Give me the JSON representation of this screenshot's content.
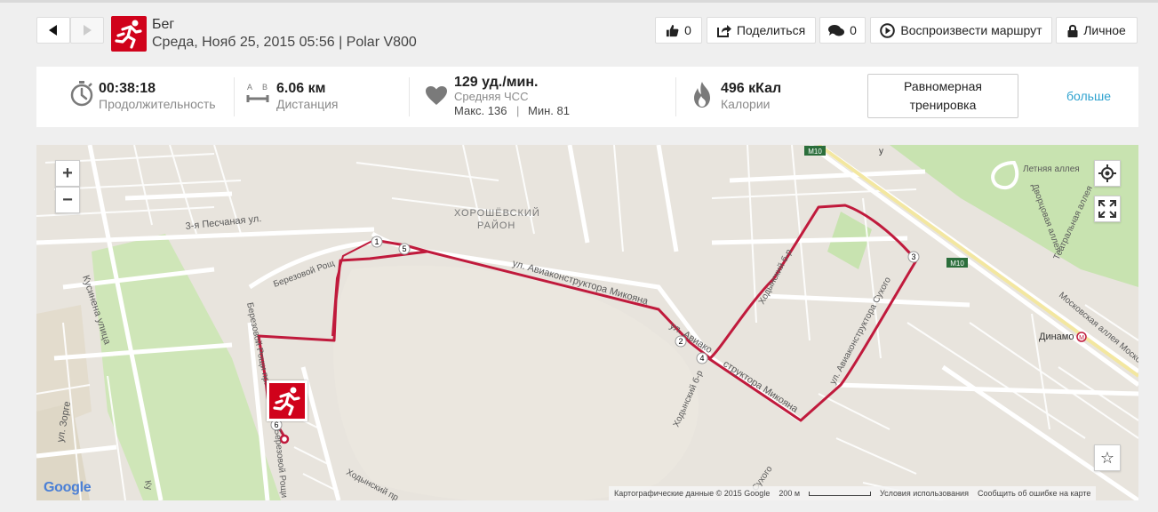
{
  "header": {
    "sport_name": "Бег",
    "subtitle": "Среда, Нояб 25, 2015 05:56 | Polar V800",
    "likes_count": "0",
    "share_label": "Поделиться",
    "comments_count": "0",
    "replay_label": "Воспроизвести маршрут",
    "privacy_label": "Личное"
  },
  "stats": {
    "duration": {
      "value": "00:38:18",
      "label": "Продолжительность"
    },
    "distance": {
      "value": "6.06 км",
      "label": "Дистанция",
      "icon_letters": [
        "A",
        "B"
      ]
    },
    "heart_rate": {
      "value": "129 уд./мин.",
      "label": "Средняя ЧСС",
      "max_label": "Макс. 136",
      "divider": "|",
      "min_label": "Мин. 81"
    },
    "calories": {
      "value": "496 кКал",
      "label": "Калории"
    },
    "training_button_line1": "Равномерная",
    "training_button_line2": "тренировка",
    "more_link": "больше"
  },
  "map": {
    "labels": {
      "district_line1": "ХОРОШЁВСКИЙ",
      "district_line2": "РАЙОН",
      "street_pesch": "3-я Песчаная ул.",
      "street_mikoyana": "ул. Авиаконструктора Микояна",
      "street_avia_short": "ул. Авиако",
      "street_mikoyana_b": "структора Микояна",
      "street_sukhogo": "ул. Авиаконструктора Сухого",
      "street_khod1": "Ходынский б-р",
      "street_khod2": "Ходынский б-р",
      "street_kusinena": "Кусинена улица",
      "street_zorge": "ул. Зорге",
      "street_berez": "Березовой Рощ",
      "street_berez2": "Березовой Рощи пр.",
      "street_berez3": "Березовой Рощи",
      "street_letnyaya": "Летняя аллея",
      "street_dvorts": "Дворцовая аллея",
      "street_teatr": "Театральная аллея",
      "street_moskov": "Московская аллея Моско",
      "street_sukhogo2": "Сухого",
      "street_khod_pr": "Ходынский пр.",
      "street_ku": "Ку",
      "station": "Динамо",
      "road_m10": "M10",
      "road_m10b": "M10",
      "road_u": "у"
    },
    "route_markers": [
      "1",
      "2",
      "3",
      "4",
      "5",
      "6"
    ],
    "google_logo": "Google",
    "attribution": {
      "data": "Картографические данные © 2015 Google",
      "scale": "200 м",
      "terms": "Условия использования",
      "report": "Сообщить об ошибке на карте"
    }
  }
}
